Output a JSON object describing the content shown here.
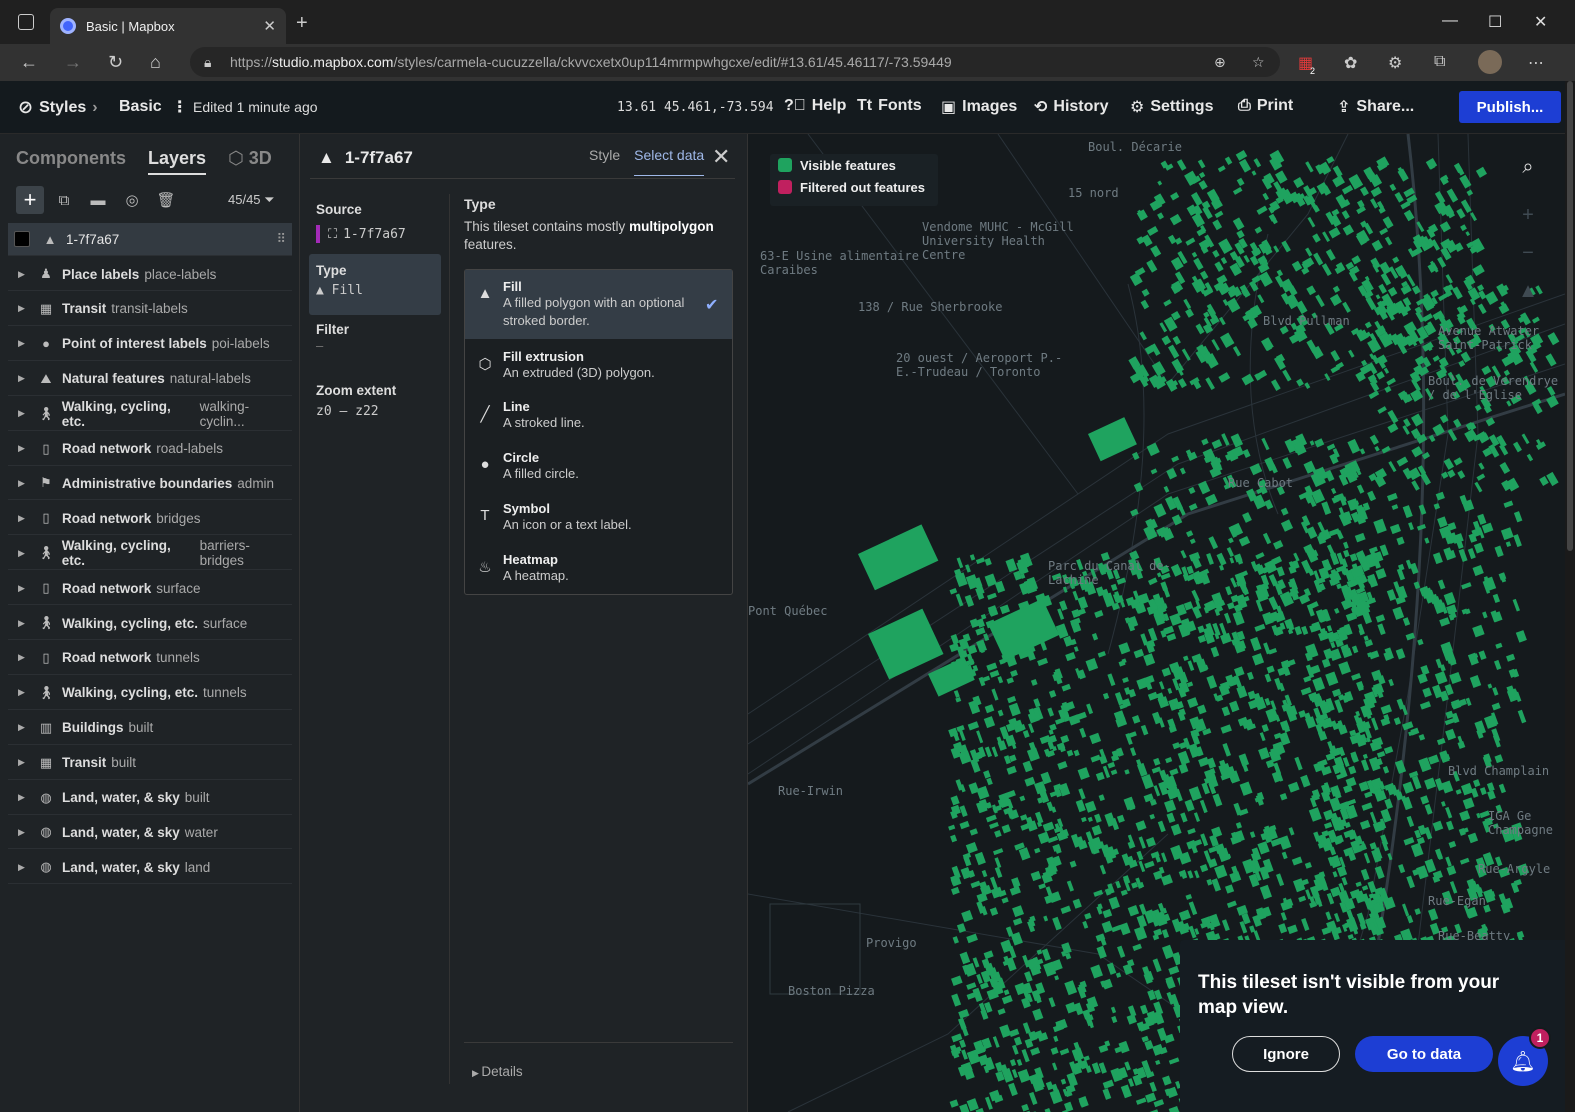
{
  "browser": {
    "tab_title": "Basic | Mapbox",
    "url_prefix": "https://",
    "url_host": "studio.mapbox.com",
    "url_path": "/styles/carmela-cucuzzella/ckvvcxetx0up114mrmpwhgcxe/edit/#13.61/45.46117/-73.59449",
    "ext_badge": "2"
  },
  "header": {
    "styles": "Styles",
    "basic": "Basic",
    "edited": "Edited 1 minute ago",
    "coords": "13.61 45.461,-73.594",
    "help": "Help",
    "fonts": "Fonts",
    "images": "Images",
    "history": "History",
    "settings": "Settings",
    "print": "Print",
    "share": "Share...",
    "publish": "Publish..."
  },
  "left": {
    "tab_components": "Components",
    "tab_layers": "Layers",
    "tab_3d": "3D",
    "count": "45/45",
    "selected_layer": "1-7f7a67",
    "layers": [
      {
        "name": "Place labels",
        "id": "place-labels",
        "icon": "person-pin"
      },
      {
        "name": "Transit",
        "id": "transit-labels",
        "icon": "bus"
      },
      {
        "name": "Point of interest labels",
        "id": "poi-labels",
        "icon": "pin"
      },
      {
        "name": "Natural features",
        "id": "natural-labels",
        "icon": "mountain"
      },
      {
        "name": "Walking, cycling, etc.",
        "id": "walking-cyclin...",
        "icon": "walker"
      },
      {
        "name": "Road network",
        "id": "road-labels",
        "icon": "road"
      },
      {
        "name": "Administrative boundaries",
        "id": "admin",
        "icon": "flag"
      },
      {
        "name": "Road network",
        "id": "bridges",
        "icon": "road"
      },
      {
        "name": "Walking, cycling, etc.",
        "id": "barriers-bridges",
        "icon": "walker"
      },
      {
        "name": "Road network",
        "id": "surface",
        "icon": "road"
      },
      {
        "name": "Walking, cycling, etc.",
        "id": "surface",
        "icon": "walker"
      },
      {
        "name": "Road network",
        "id": "tunnels",
        "icon": "road"
      },
      {
        "name": "Walking, cycling, etc.",
        "id": "tunnels",
        "icon": "walker"
      },
      {
        "name": "Buildings",
        "id": "built",
        "icon": "building"
      },
      {
        "name": "Transit",
        "id": "built",
        "icon": "bus"
      },
      {
        "name": "Land, water, & sky",
        "id": "built",
        "icon": "globe"
      },
      {
        "name": "Land, water, & sky",
        "id": "water",
        "icon": "globe"
      },
      {
        "name": "Land, water, & sky",
        "id": "land",
        "icon": "globe"
      }
    ]
  },
  "mid": {
    "title": "1-7f7a67",
    "tab_style": "Style",
    "tab_select": "Select data",
    "source_label": "Source",
    "source_value": "1-7f7a67",
    "type_label": "Type",
    "type_value": "Fill",
    "filter_label": "Filter",
    "filter_value": "–",
    "zoom_label": "Zoom extent",
    "zoom_value": "z0 — z22",
    "right_title": "Type",
    "desc_pre": "This tileset contains mostly ",
    "desc_bold": "multipolygon",
    "desc_post": " features.",
    "options": [
      {
        "title": "Fill",
        "desc": "A filled polygon with an optional stroked border.",
        "icon": "fill-icon"
      },
      {
        "title": "Fill extrusion",
        "desc": "An extruded (3D) polygon.",
        "icon": "extrusion-icon"
      },
      {
        "title": "Line",
        "desc": "A stroked line.",
        "icon": "line-icon"
      },
      {
        "title": "Circle",
        "desc": "A filled circle.",
        "icon": "circle-icon"
      },
      {
        "title": "Symbol",
        "desc": "An icon or a text label.",
        "icon": "symbol-icon"
      },
      {
        "title": "Heatmap",
        "desc": "A heatmap.",
        "icon": "heatmap-icon"
      }
    ],
    "details": "Details"
  },
  "map": {
    "legend_visible": "Visible features",
    "legend_filtered": "Filtered out features",
    "visible_color": "#1fa35f",
    "filtered_color": "#c0205f",
    "labels": [
      "Boul. Décarie",
      "15 nord",
      "Vendome MUHC - McGill University Health Centre",
      "63-E Usine alimentaire Caraibes",
      "138 / Rue Sherbrooke",
      "20 ouest / Aeroport P.-E.-Trudeau / Toronto",
      "Blvd Pullman",
      "Rue Cabot",
      "Parc du Canal de-Lachine",
      "Avenue Atwater Saint-Patrick",
      "Boul. de Verendrye / de l'Eglise",
      "Provigo",
      "Boston Pizza",
      "Rue-Irwin",
      "Pont Québec",
      "Rue-Beatty",
      "Rue-Egan",
      "Blvd Champlain",
      "IGA Ge Champagne",
      "Rue-Argyle"
    ],
    "toast_text": "This tileset isn't visible from your map view.",
    "ignore": "Ignore",
    "go": "Go to data",
    "notif_count": "1"
  }
}
